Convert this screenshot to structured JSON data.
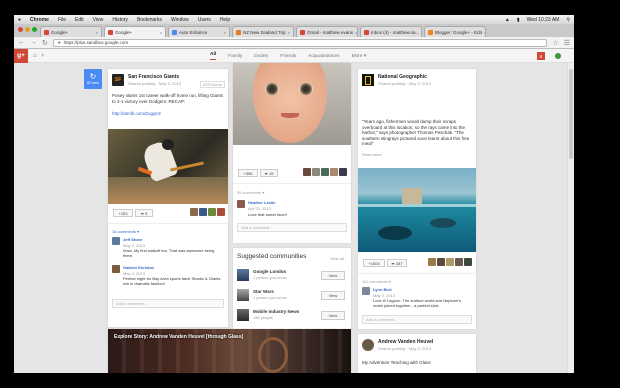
{
  "menubar": {
    "app": "Chrome",
    "items": [
      "File",
      "Edit",
      "View",
      "History",
      "Bookmarks",
      "Window",
      "Users",
      "Help"
    ],
    "clock": "Wed 10:23 AM"
  },
  "tabs": [
    {
      "label": "Google+",
      "color": "#d14836"
    },
    {
      "label": "Google+",
      "color": "#d14836"
    },
    {
      "label": "Auto Enhance",
      "color": "#4a8af4"
    },
    {
      "label": "NZ New Zealand Trip",
      "color": "#e07b2a"
    },
    {
      "label": "Gmail - matthew evans",
      "color": "#d14836"
    },
    {
      "label": "Inbox (4) - matthew.sa...",
      "color": "#d14836"
    },
    {
      "label": "Blogger: Google+ - Edit",
      "color": "#f58220"
    }
  ],
  "address": {
    "url": "https://plus.sandbox.google.com"
  },
  "header": {
    "logo": "g+",
    "filters": [
      "All",
      "Family",
      "Dudes",
      "Friends",
      "Acquaintances",
      "More"
    ],
    "notifications": "8"
  },
  "new_posts": {
    "count": "82 new"
  },
  "post_giants": {
    "author": "San Francisco Giants",
    "meta": "Shared publicly · May 3, 2013",
    "hashtag": "#SFGiants",
    "text": "Posey slams 1st career walk-off home run, lifting Giants to 2-1 victory over Dodgers: RECAP:",
    "link": "http://atmlb.com/ZugqHz",
    "plus": "+153",
    "shares": "9",
    "comments_label": "16 comments",
    "comments": [
      {
        "name": "Jeff Stone",
        "meta": "May 3, 2013",
        "text": "Wow, My first walkoff too. That was awesome being there."
      },
      {
        "name": "Gabriel Khristov",
        "meta": "May 3, 2013",
        "text": "Perfect night for Bay Area sports fans! Sharks & Giants win in dramatic fashion!"
      }
    ],
    "add_comment": "Add a comment..."
  },
  "post_baby": {
    "plus": "+355",
    "shares": "19",
    "comments_label": "35 comments",
    "comment": {
      "name": "Heather Leslie",
      "meta": "Apr 23, 2013",
      "text": "Love that sweet face!!"
    },
    "add_comment": "Add a comment..."
  },
  "suggested": {
    "title": "Suggested communities",
    "view_all": "View all",
    "items": [
      {
        "name": "Google London",
        "meta": "1 person you know",
        "button": "View"
      },
      {
        "name": "Star Wars",
        "meta": "1 person you know",
        "button": "View"
      },
      {
        "name": "Mobile Industry News",
        "meta": "186 people",
        "button": "View"
      }
    ]
  },
  "post_natgeo": {
    "author": "National Geographic",
    "meta": "Shared publicly · May 3, 2013",
    "quote": "\"Years ago, fishermen would dump their scraps overboard at this location, so the rays came into the harbor,\" says photographer Thomas Peschak. \"The southern stingrays pictured soon learnt about this free meal\"",
    "read_more": "Read more",
    "plus": "+1504",
    "shares": "287",
    "comments_label": "111 comments",
    "comment": {
      "name": "Lynn Bird",
      "meta": "May 3, 2013",
      "text": "Love it! Lagoon. The surface world and Neptune's realm joined together - a perfect shot."
    },
    "add_comment": "Add a comment..."
  },
  "post_glass": {
    "title": "Explore Story: Andrew Vanden Heuvel [through Glass]"
  },
  "post_andrew": {
    "author": "Andrew Vanden Heuvel",
    "meta": "Shared publicly · May 3, 2013",
    "text": "My Adventure Teaching with Glass"
  }
}
